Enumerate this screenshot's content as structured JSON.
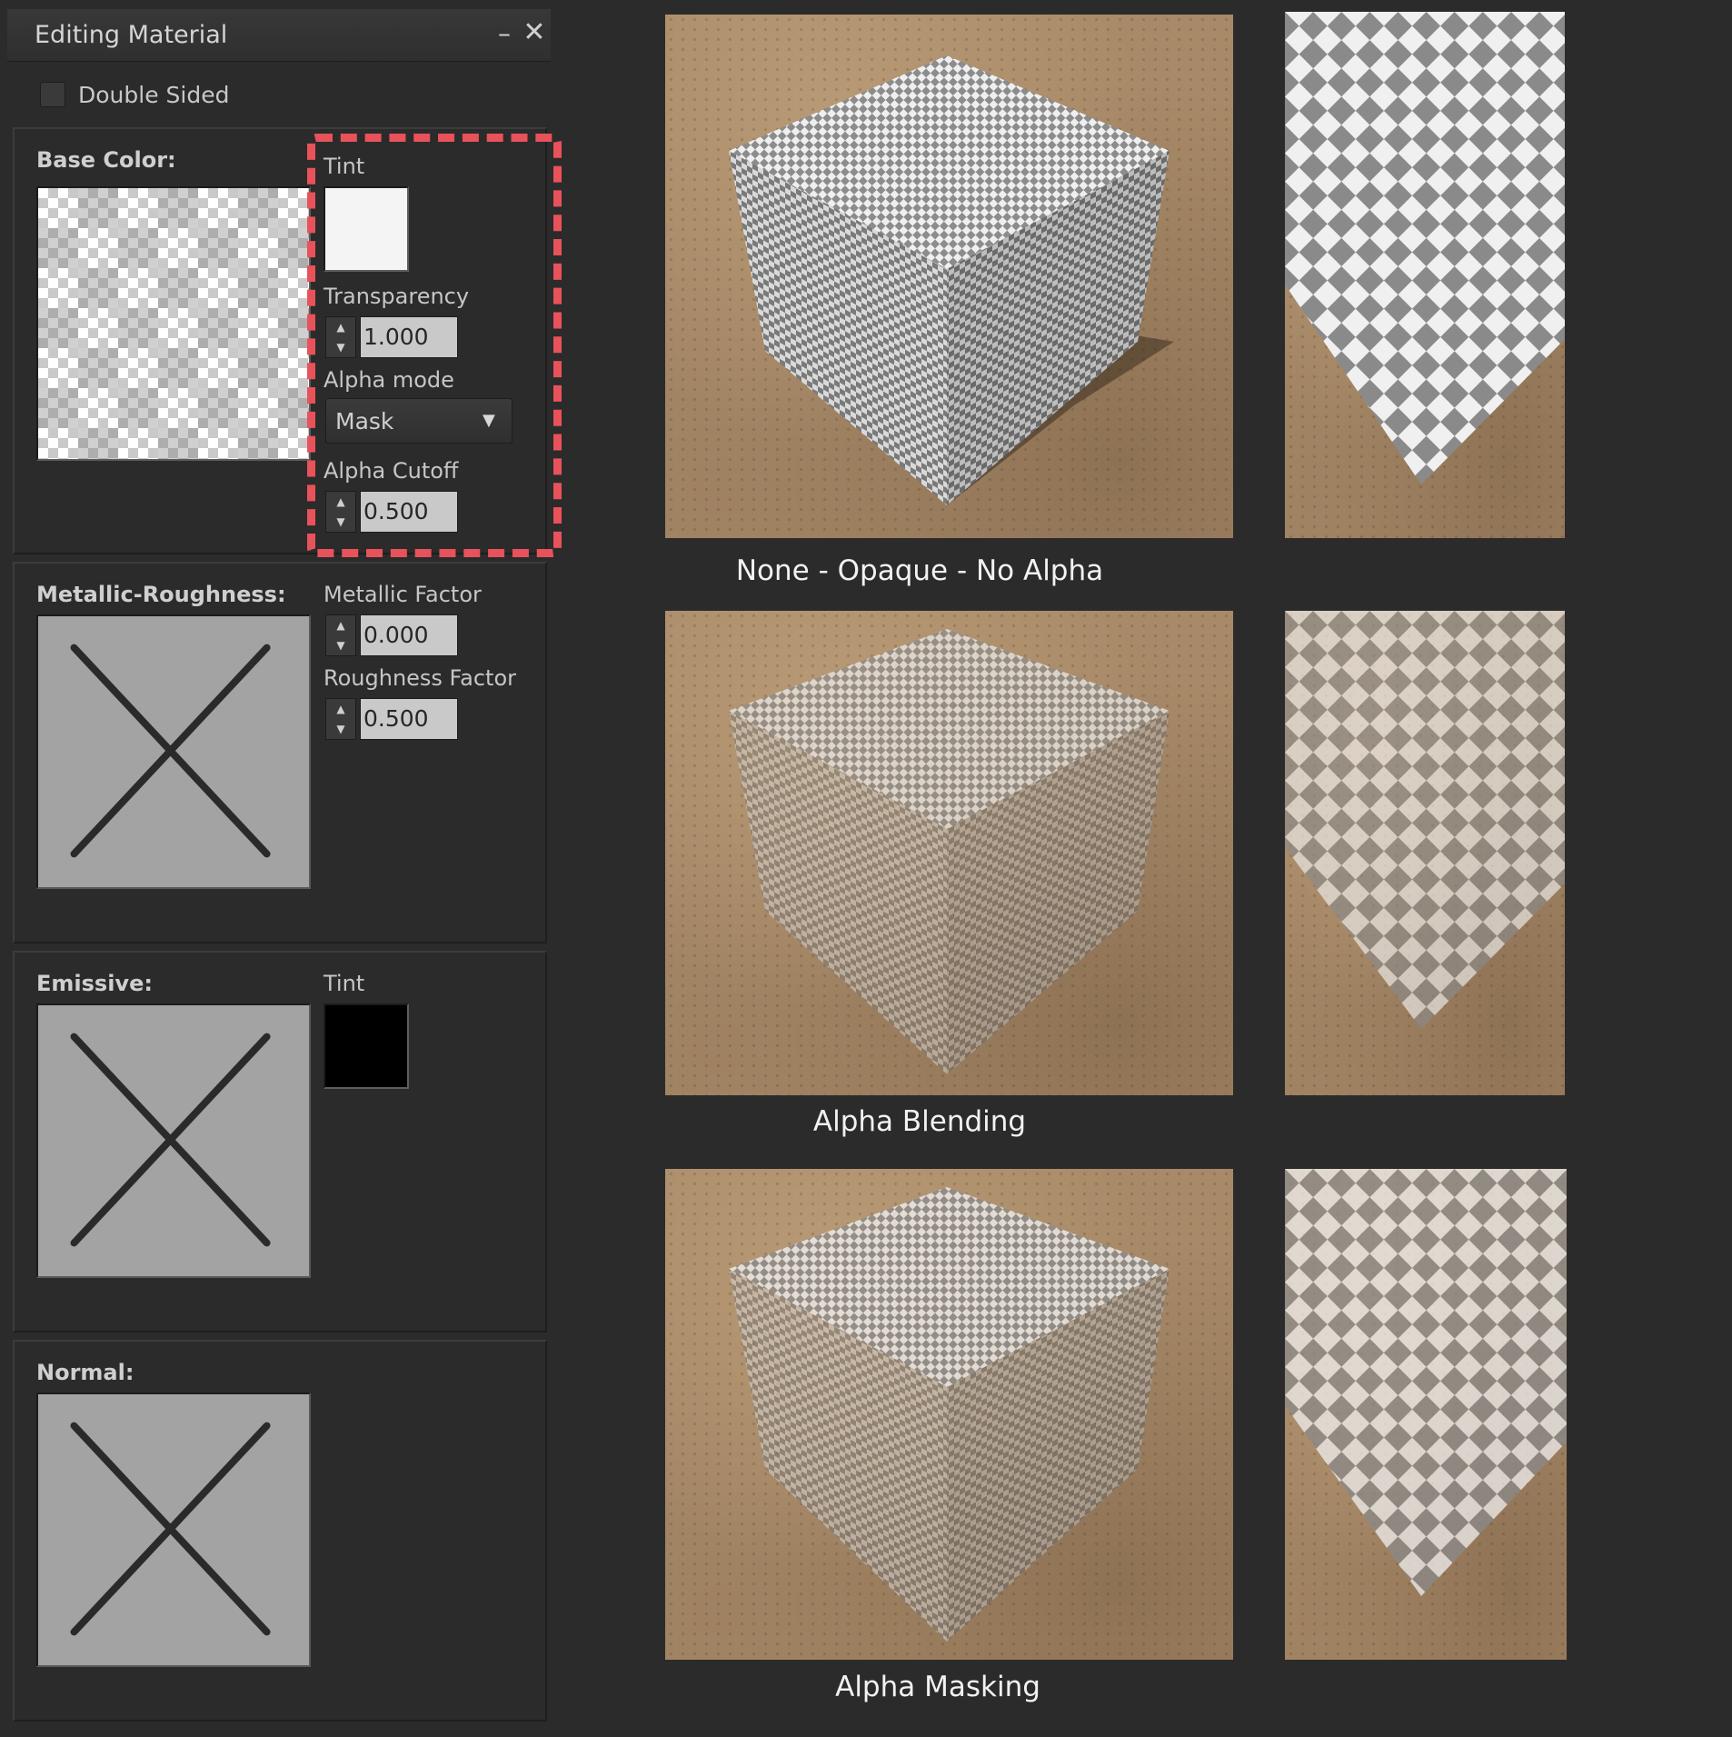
{
  "window": {
    "title": "Editing Material",
    "minimize_glyph": "–",
    "close_glyph": "✕"
  },
  "double_sided": {
    "label": "Double Sided",
    "checked": false
  },
  "base_color": {
    "title": "Base Color:",
    "tint_label": "Tint",
    "tint_color": "#f4f4f4",
    "transparency_label": "Transparency",
    "transparency_value": "1.000",
    "alpha_mode_label": "Alpha mode",
    "alpha_mode_value": "Mask",
    "alpha_cutoff_label": "Alpha Cutoff",
    "alpha_cutoff_value": "0.500"
  },
  "metallic_roughness": {
    "title": "Metallic-Roughness:",
    "metallic_label": "Metallic Factor",
    "metallic_value": "0.000",
    "roughness_label": "Roughness Factor",
    "roughness_value": "0.500"
  },
  "emissive": {
    "title": "Emissive:",
    "tint_label": "Tint",
    "tint_color": "#000000"
  },
  "normal": {
    "title": "Normal:"
  },
  "highlight_color": "#e8525a",
  "comparisons": [
    {
      "caption": "None - Opaque - No Alpha"
    },
    {
      "caption": "Alpha Blending"
    },
    {
      "caption": "Alpha Masking"
    }
  ]
}
